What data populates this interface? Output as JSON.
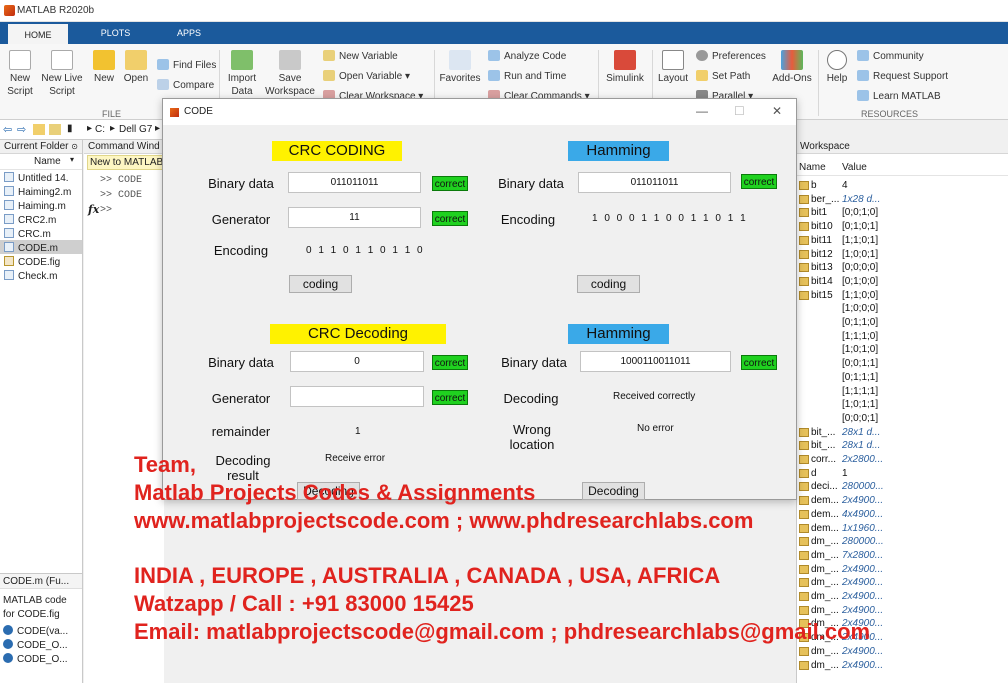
{
  "app": {
    "title": "MATLAB R2020b"
  },
  "ribbon_tabs": [
    "HOME",
    "PLOTS",
    "APPS"
  ],
  "ribbon": {
    "new_script": "New Script",
    "new_live_script": "New Live Script",
    "new": "New",
    "open": "Open",
    "find_files": "Find Files",
    "compare": "Compare",
    "import_data": "Import Data",
    "save_workspace": "Save Workspace",
    "new_variable": "New Variable",
    "open_variable": "Open Variable",
    "clear_workspace": "Clear Workspace",
    "favorites": "Favorites",
    "analyze_code": "Analyze Code",
    "run_and_time": "Run and Time",
    "clear_commands": "Clear Commands",
    "simulink": "Simulink",
    "layout": "Layout",
    "preferences": "Preferences",
    "set_path": "Set Path",
    "parallel": "Parallel",
    "add_ons": "Add-Ons",
    "help": "Help",
    "community": "Community",
    "request_support": "Request Support",
    "learn_matlab": "Learn MATLAB",
    "section_file": "FILE",
    "section_resources": "RESOURCES"
  },
  "address": {
    "drive": "C:",
    "folder": "Dell G7"
  },
  "current_folder": {
    "title": "Current Folder",
    "column": "Name",
    "files": [
      "Untitled 14.",
      "Haiming2.m",
      "Haiming.m",
      "CRC2.m",
      "CRC.m",
      "CODE.m",
      "CODE.fig",
      "Check.m"
    ],
    "detail_title": "CODE.m (Fu...",
    "detail_desc1": "MATLAB code",
    "detail_desc2": "for CODE.fig",
    "detail_items": [
      "CODE(va...",
      "CODE_O...",
      "CODE_O..."
    ]
  },
  "command_window": {
    "title": "Command Wind",
    "tip": "New to MATLAB",
    "lines": [
      ">> CODE",
      ">> CODE",
      ">>"
    ],
    "fx": "fx"
  },
  "workspace": {
    "title": "Workspace",
    "col_name": "Name",
    "col_value": "Value",
    "rows": [
      {
        "name": "b",
        "value": "4",
        "italic": false
      },
      {
        "name": "ber_...",
        "value": "1x28 d...",
        "italic": true
      },
      {
        "name": "bit1",
        "value": "[0;0;1;0]",
        "italic": false
      },
      {
        "name": "bit10",
        "value": "[0;1;0;1]",
        "italic": false
      },
      {
        "name": "bit11",
        "value": "[1;1;0;1]",
        "italic": false
      },
      {
        "name": "bit12",
        "value": "[1;0;0;1]",
        "italic": false
      },
      {
        "name": "bit13",
        "value": "[0;0;0;0]",
        "italic": false
      },
      {
        "name": "bit14",
        "value": "[0;1;0;0]",
        "italic": false
      },
      {
        "name": "bit15",
        "value": "[1;1;0;0]",
        "italic": false
      },
      {
        "name": "",
        "value": "[1;0;0;0]",
        "italic": false
      },
      {
        "name": "",
        "value": "[0;1;1;0]",
        "italic": false
      },
      {
        "name": "",
        "value": "[1;1;1;0]",
        "italic": false
      },
      {
        "name": "",
        "value": "[1;0;1;0]",
        "italic": false
      },
      {
        "name": "",
        "value": "[0;0;1;1]",
        "italic": false
      },
      {
        "name": "",
        "value": "[0;1;1;1]",
        "italic": false
      },
      {
        "name": "",
        "value": "[1;1;1;1]",
        "italic": false
      },
      {
        "name": "",
        "value": "[1;0;1;1]",
        "italic": false
      },
      {
        "name": "",
        "value": "[0;0;0;1]",
        "italic": false
      },
      {
        "name": "bit_...",
        "value": "28x1 d...",
        "italic": true
      },
      {
        "name": "bit_...",
        "value": "28x1 d...",
        "italic": true
      },
      {
        "name": "corr...",
        "value": "2x2800...",
        "italic": true
      },
      {
        "name": "d",
        "value": "1",
        "italic": false
      },
      {
        "name": "deci...",
        "value": "280000...",
        "italic": true
      },
      {
        "name": "dem...",
        "value": "2x4900...",
        "italic": true
      },
      {
        "name": "dem...",
        "value": "4x4900...",
        "italic": true
      },
      {
        "name": "dem...",
        "value": "1x1960...",
        "italic": true
      },
      {
        "name": "dm_...",
        "value": "280000...",
        "italic": true
      },
      {
        "name": "dm_...",
        "value": "7x2800...",
        "italic": true
      },
      {
        "name": "dm_...",
        "value": "2x4900...",
        "italic": true
      },
      {
        "name": "dm_...",
        "value": "2x4900...",
        "italic": true
      },
      {
        "name": "dm_...",
        "value": "2x4900...",
        "italic": true
      },
      {
        "name": "dm_...",
        "value": "2x4900...",
        "italic": true
      },
      {
        "name": "dm_...",
        "value": "2x4900...",
        "italic": true
      },
      {
        "name": "dm_...",
        "value": "2x4900...",
        "italic": true
      },
      {
        "name": "dm_...",
        "value": "2x4900...",
        "italic": true
      },
      {
        "name": "dm_...",
        "value": "2x4900...",
        "italic": true
      }
    ]
  },
  "dialog": {
    "title": "CODE",
    "controls": {
      "minimize": "—",
      "maximize": "☐",
      "close": "✕"
    },
    "crc_coding": {
      "header": "CRC CODING",
      "binary_label": "Binary data",
      "binary_value": "011011011",
      "generator_label": "Generator",
      "generator_value": "11",
      "encoding_label": "Encoding",
      "encoding_value": "0 1 1 0 1 1 0 1 1 0",
      "button": "coding"
    },
    "hamming_coding": {
      "header": "Hamming",
      "binary_label": "Binary data",
      "binary_value": "011011011",
      "encoding_label": "Encoding",
      "encoding_value": "1 0 0 0 1 1 0 0 1 1 0 1 1",
      "button": "coding"
    },
    "crc_decoding": {
      "header": "CRC Decoding",
      "binary_label": "Binary data",
      "binary_value": "0",
      "generator_label": "Generator",
      "generator_value": "",
      "remainder_label": "remainder",
      "remainder_value": "1",
      "result_label_1": "Decoding",
      "result_label_2": "result",
      "result_value": "Receive error",
      "button": "Decoding"
    },
    "hamming_decoding": {
      "header": "Hamming",
      "binary_label": "Binary data",
      "binary_value": "1000110011011",
      "decoding_label": "Decoding",
      "decoding_value": "Received correctly",
      "wrong_label_1": "Wrong",
      "wrong_label_2": "location",
      "wrong_value": "No error",
      "button": "Decoding"
    },
    "correct": "correct"
  },
  "overlay": {
    "line1": "Team,",
    "line2": "Matlab Projects Codes & Assignments",
    "line3": "www.matlabprojectscode.com ; www.phdresearchlabs.com",
    "line4": "INDIA , EUROPE , AUSTRALIA , CANADA , USA, AFRICA",
    "line5": "Watzapp / Call : +91 83000 15425",
    "line6": "Email: matlabprojectscode@gmail.com ; phdresearchlabs@gmail.com"
  },
  "colors": {
    "ribbon_blue": "#1b5a9c",
    "ok_green": "#1fd11f",
    "yellow": "#fff200",
    "blue_header": "#3aa9e8",
    "overlay_red": "#e0231e"
  }
}
